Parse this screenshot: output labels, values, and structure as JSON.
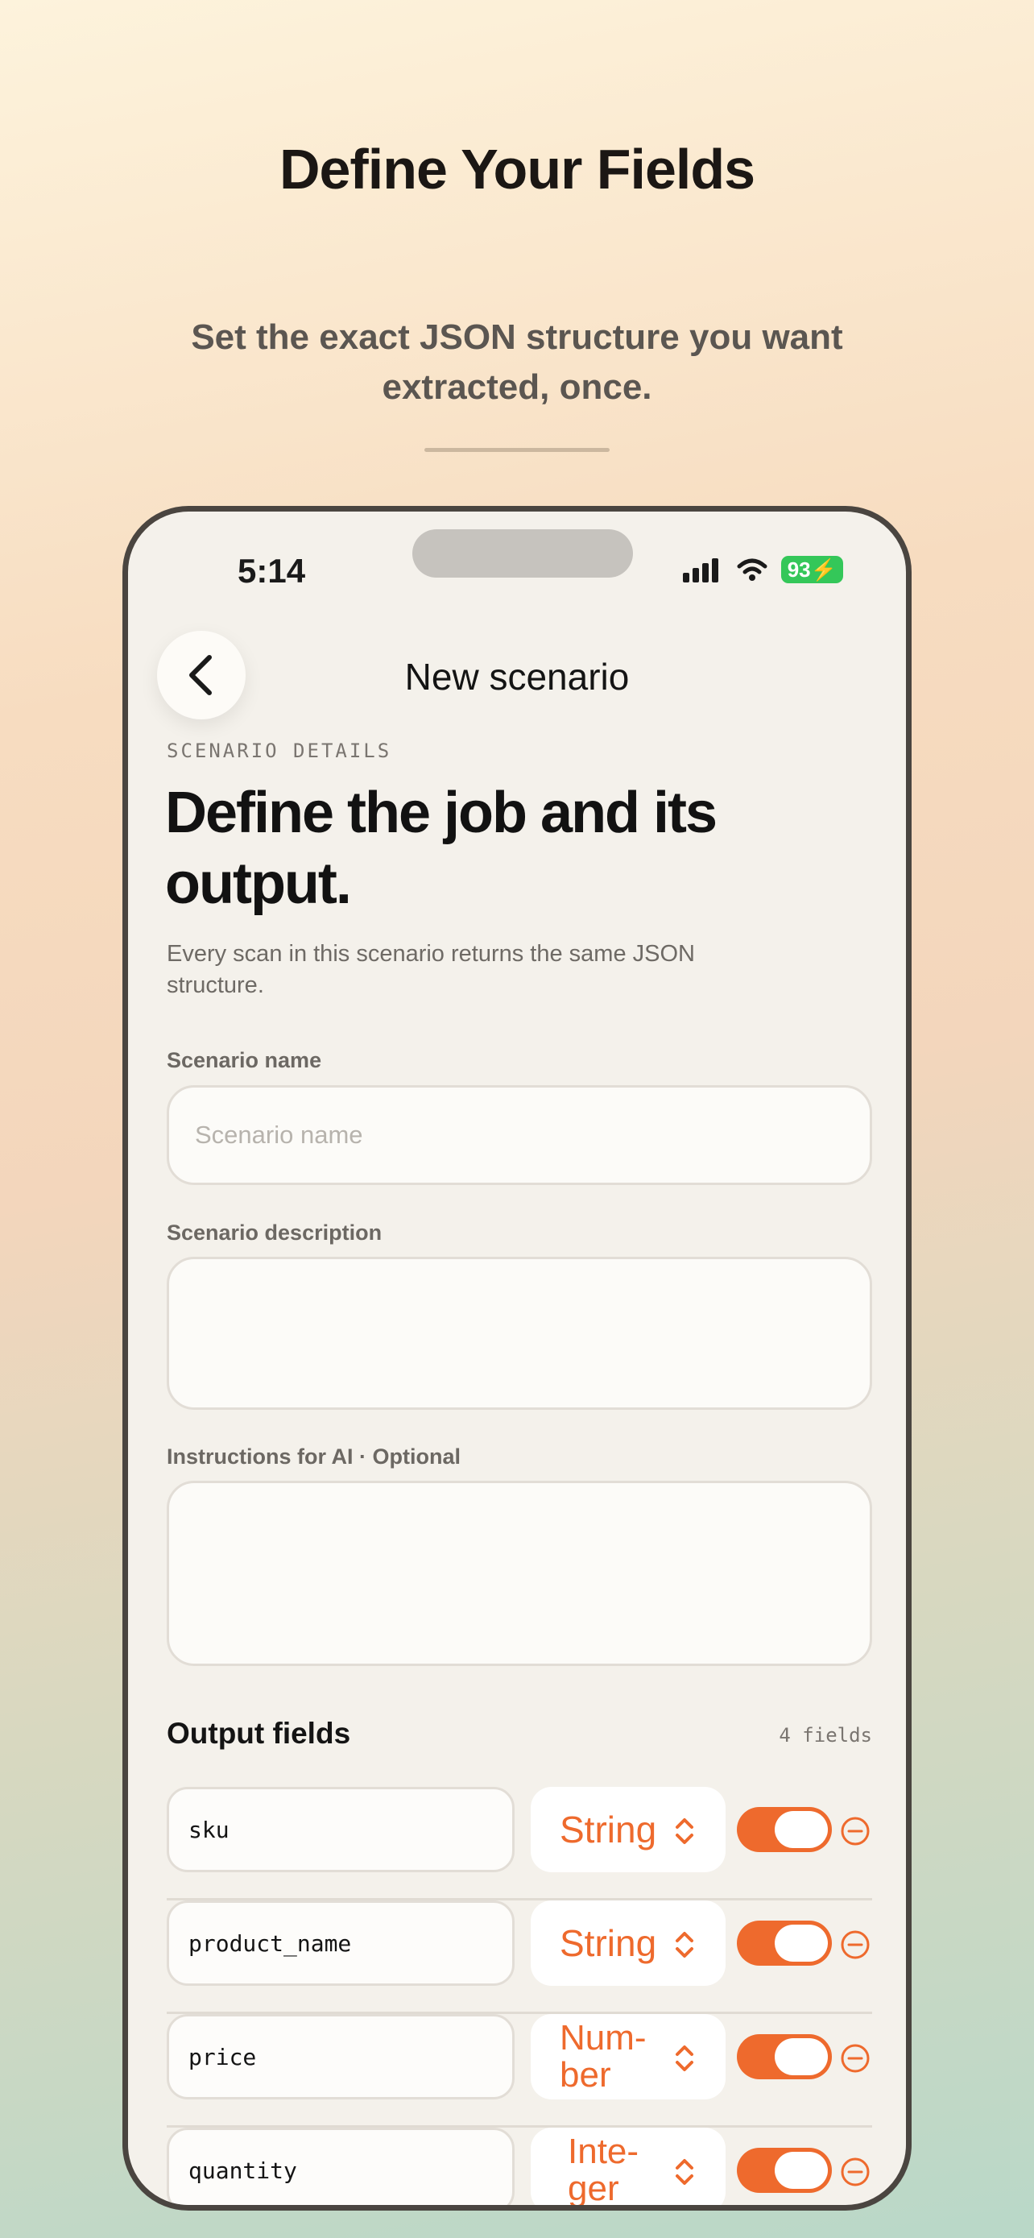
{
  "promo": {
    "title": "Define Your Fields",
    "subtitle": "Set the exact JSON structure you want extracted, once."
  },
  "status_bar": {
    "time": "5:14",
    "battery": "93"
  },
  "nav": {
    "title": "New scenario",
    "back_icon": "chevron-left-icon"
  },
  "hero": {
    "eyebrow": "SCENARIO DETAILS",
    "headline": "Define the job and its output.",
    "lede": "Every scan in this scenario returns the same JSON structure."
  },
  "form": {
    "name_label": "Scenario name",
    "name_placeholder": "Scenario name",
    "name_value": "",
    "description_label": "Scenario description",
    "description_value": "",
    "instructions_label": "Instructions for AI · Optional",
    "instructions_value": ""
  },
  "output_fields": {
    "title": "Output fields",
    "count": "4 fields",
    "rows": [
      {
        "name": "sku",
        "type": "String",
        "enabled": true
      },
      {
        "name": "product_name",
        "type": "String",
        "enabled": true
      },
      {
        "name": "price",
        "type": "Num-ber",
        "enabled": true
      },
      {
        "name": "quantity",
        "type": "Inte-ger",
        "enabled": true
      }
    ]
  },
  "colors": {
    "accent": "#ee6a2d",
    "battery": "#34c759",
    "card_bg": "#f4f1eb"
  }
}
